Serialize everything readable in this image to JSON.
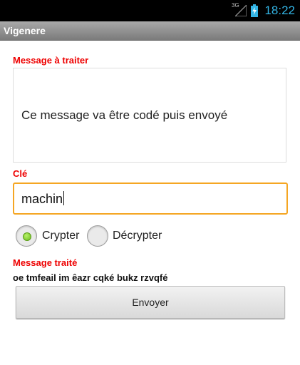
{
  "status_bar": {
    "network": "3G",
    "time": "18:22"
  },
  "app": {
    "title": "Vigenere"
  },
  "form": {
    "message_label": "Message à traiter",
    "message_value": "Ce message va être codé puis envoyé",
    "key_label": "Clé",
    "key_value": "machin",
    "mode_options": [
      {
        "label": "Crypter",
        "selected": true
      },
      {
        "label": "Décrypter",
        "selected": false
      }
    ],
    "result_label": "Message traité",
    "result_value": "oe tmfeail im êazr cqké bukz rzvqfé",
    "send_label": "Envoyer"
  },
  "colors": {
    "label_red": "#ee0000",
    "focus_orange": "#f5a623",
    "status_blue": "#33b5e5"
  }
}
